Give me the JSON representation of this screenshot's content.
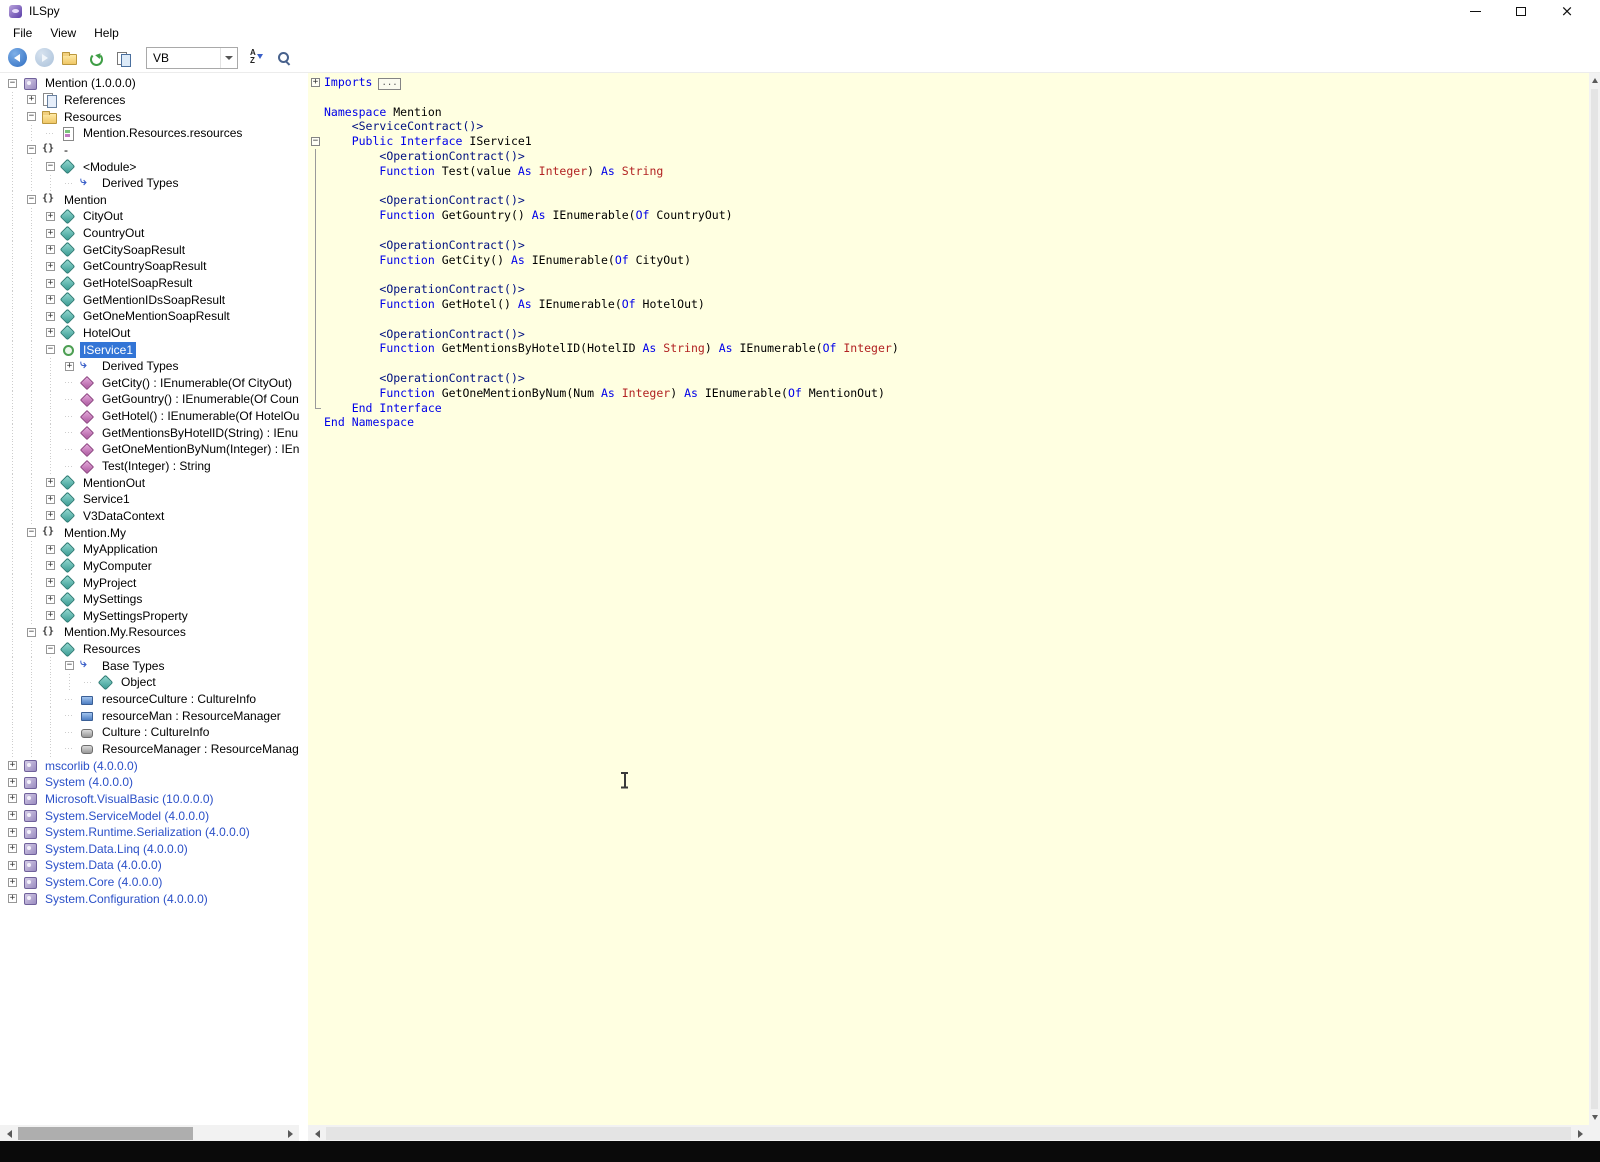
{
  "window": {
    "title": "ILSpy"
  },
  "menu": {
    "items": [
      "File",
      "View",
      "Help"
    ]
  },
  "toolbar": {
    "language": "VB"
  },
  "colors": {
    "code_background": "#FFFFE1",
    "tree_selection": "#3375D6",
    "keyword": "#0000E8",
    "builtin_type": "#B22222",
    "attribute": "#001080",
    "assembly_reference_text": "#2B50C8"
  },
  "tree": [
    {
      "d": 0,
      "e": "-",
      "i": "assembly",
      "t": "Mention (1.0.0.0)"
    },
    {
      "d": 1,
      "e": "+",
      "i": "references",
      "t": "References"
    },
    {
      "d": 1,
      "e": "-",
      "i": "folder",
      "t": "Resources"
    },
    {
      "d": 2,
      "e": "",
      "i": "resource",
      "t": "Mention.Resources.resources"
    },
    {
      "d": 1,
      "e": "-",
      "i": "namespace",
      "t": "-"
    },
    {
      "d": 2,
      "e": "-",
      "i": "class",
      "t": "<Module>"
    },
    {
      "d": 3,
      "e": "",
      "i": "derived",
      "t": "Derived Types"
    },
    {
      "d": 1,
      "e": "-",
      "i": "namespace",
      "t": "Mention"
    },
    {
      "d": 2,
      "e": "+",
      "i": "class",
      "t": "CityOut"
    },
    {
      "d": 2,
      "e": "+",
      "i": "class",
      "t": "CountryOut"
    },
    {
      "d": 2,
      "e": "+",
      "i": "class",
      "t": "GetCitySoapResult"
    },
    {
      "d": 2,
      "e": "+",
      "i": "class",
      "t": "GetCountrySoapResult"
    },
    {
      "d": 2,
      "e": "+",
      "i": "class",
      "t": "GetHotelSoapResult"
    },
    {
      "d": 2,
      "e": "+",
      "i": "class",
      "t": "GetMentionIDsSoapResult"
    },
    {
      "d": 2,
      "e": "+",
      "i": "class",
      "t": "GetOneMentionSoapResult"
    },
    {
      "d": 2,
      "e": "+",
      "i": "class",
      "t": "HotelOut"
    },
    {
      "d": 2,
      "e": "-",
      "i": "interface",
      "t": "IService1",
      "sel": true
    },
    {
      "d": 3,
      "e": "+",
      "i": "derived",
      "t": "Derived Types"
    },
    {
      "d": 3,
      "e": "",
      "i": "method",
      "t": "GetCity() : IEnumerable(Of CityOut)"
    },
    {
      "d": 3,
      "e": "",
      "i": "method",
      "t": "GetGountry() : IEnumerable(Of CountryOut)"
    },
    {
      "d": 3,
      "e": "",
      "i": "method",
      "t": "GetHotel() : IEnumerable(Of HotelOut)"
    },
    {
      "d": 3,
      "e": "",
      "i": "method",
      "t": "GetMentionsByHotelID(String) : IEnumerable(Of Integer)"
    },
    {
      "d": 3,
      "e": "",
      "i": "method",
      "t": "GetOneMentionByNum(Integer) : IEnumerable(Of MentionOut)"
    },
    {
      "d": 3,
      "e": "",
      "i": "method",
      "t": "Test(Integer) : String"
    },
    {
      "d": 2,
      "e": "+",
      "i": "class",
      "t": "MentionOut"
    },
    {
      "d": 2,
      "e": "+",
      "i": "class",
      "t": "Service1"
    },
    {
      "d": 2,
      "e": "+",
      "i": "class",
      "t": "V3DataContext"
    },
    {
      "d": 1,
      "e": "-",
      "i": "namespace",
      "t": "Mention.My"
    },
    {
      "d": 2,
      "e": "+",
      "i": "class",
      "t": "MyApplication"
    },
    {
      "d": 2,
      "e": "+",
      "i": "class",
      "t": "MyComputer"
    },
    {
      "d": 2,
      "e": "+",
      "i": "class",
      "t": "MyProject"
    },
    {
      "d": 2,
      "e": "+",
      "i": "class",
      "t": "MySettings"
    },
    {
      "d": 2,
      "e": "+",
      "i": "class",
      "t": "MySettingsProperty"
    },
    {
      "d": 1,
      "e": "-",
      "i": "namespace",
      "t": "Mention.My.Resources"
    },
    {
      "d": 2,
      "e": "-",
      "i": "class",
      "t": "Resources"
    },
    {
      "d": 3,
      "e": "-",
      "i": "derived",
      "t": "Base Types"
    },
    {
      "d": 4,
      "e": "",
      "i": "class",
      "t": "Object"
    },
    {
      "d": 3,
      "e": "",
      "i": "field",
      "t": "resourceCulture : CultureInfo"
    },
    {
      "d": 3,
      "e": "",
      "i": "field",
      "t": "resourceMan : ResourceManager"
    },
    {
      "d": 3,
      "e": "",
      "i": "property",
      "t": "Culture : CultureInfo"
    },
    {
      "d": 3,
      "e": "",
      "i": "property",
      "t": "ResourceManager : ResourceManager"
    },
    {
      "d": 0,
      "e": "+",
      "i": "assembly",
      "t": "mscorlib (4.0.0.0)",
      "blue": true
    },
    {
      "d": 0,
      "e": "+",
      "i": "assembly",
      "t": "System (4.0.0.0)",
      "blue": true
    },
    {
      "d": 0,
      "e": "+",
      "i": "assembly",
      "t": "Microsoft.VisualBasic (10.0.0.0)",
      "blue": true
    },
    {
      "d": 0,
      "e": "+",
      "i": "assembly",
      "t": "System.ServiceModel (4.0.0.0)",
      "blue": true
    },
    {
      "d": 0,
      "e": "+",
      "i": "assembly",
      "t": "System.Runtime.Serialization (4.0.0.0)",
      "blue": true
    },
    {
      "d": 0,
      "e": "+",
      "i": "assembly",
      "t": "System.Data.Linq (4.0.0.0)",
      "blue": true
    },
    {
      "d": 0,
      "e": "+",
      "i": "assembly",
      "t": "System.Data (4.0.0.0)",
      "blue": true
    },
    {
      "d": 0,
      "e": "+",
      "i": "assembly",
      "t": "System.Core (4.0.0.0)",
      "blue": true
    },
    {
      "d": 0,
      "e": "+",
      "i": "assembly",
      "t": "System.Configuration (4.0.0.0)",
      "blue": true
    }
  ],
  "code": {
    "lines": [
      {
        "fold": "plus",
        "seg": [
          [
            "k",
            "Imports"
          ]
        ],
        "box": "..."
      },
      {
        "seg": []
      },
      {
        "seg": [
          [
            "k",
            "Namespace"
          ],
          [
            "p",
            " Mention"
          ]
        ]
      },
      {
        "ind": 1,
        "seg": [
          [
            "a",
            "<ServiceContract()>"
          ]
        ]
      },
      {
        "fold": "minus",
        "ind": 1,
        "seg": [
          [
            "k",
            "Public Interface"
          ],
          [
            "p",
            " IService1"
          ]
        ]
      },
      {
        "fold": "line",
        "ind": 2,
        "seg": [
          [
            "a",
            "<OperationContract()>"
          ]
        ]
      },
      {
        "fold": "line",
        "ind": 2,
        "seg": [
          [
            "k",
            "Function"
          ],
          [
            "p",
            " Test(value "
          ],
          [
            "k",
            "As"
          ],
          [
            "t",
            " Integer"
          ],
          [
            "p",
            ") "
          ],
          [
            "k",
            "As"
          ],
          [
            "t",
            " String"
          ]
        ]
      },
      {
        "fold": "line",
        "seg": []
      },
      {
        "fold": "line",
        "ind": 2,
        "seg": [
          [
            "a",
            "<OperationContract()>"
          ]
        ]
      },
      {
        "fold": "line",
        "ind": 2,
        "seg": [
          [
            "k",
            "Function"
          ],
          [
            "p",
            " GetGountry() "
          ],
          [
            "k",
            "As"
          ],
          [
            "p",
            " IEnumerable("
          ],
          [
            "k",
            "Of"
          ],
          [
            "p",
            " CountryOut)"
          ]
        ]
      },
      {
        "fold": "line",
        "seg": []
      },
      {
        "fold": "line",
        "ind": 2,
        "seg": [
          [
            "a",
            "<OperationContract()>"
          ]
        ]
      },
      {
        "fold": "line",
        "ind": 2,
        "seg": [
          [
            "k",
            "Function"
          ],
          [
            "p",
            " GetCity() "
          ],
          [
            "k",
            "As"
          ],
          [
            "p",
            " IEnumerable("
          ],
          [
            "k",
            "Of"
          ],
          [
            "p",
            " CityOut)"
          ]
        ]
      },
      {
        "fold": "line",
        "seg": []
      },
      {
        "fold": "line",
        "ind": 2,
        "seg": [
          [
            "a",
            "<OperationContract()>"
          ]
        ]
      },
      {
        "fold": "line",
        "ind": 2,
        "seg": [
          [
            "k",
            "Function"
          ],
          [
            "p",
            " GetHotel() "
          ],
          [
            "k",
            "As"
          ],
          [
            "p",
            " IEnumerable("
          ],
          [
            "k",
            "Of"
          ],
          [
            "p",
            " HotelOut)"
          ]
        ]
      },
      {
        "fold": "line",
        "seg": []
      },
      {
        "fold": "line",
        "ind": 2,
        "seg": [
          [
            "a",
            "<OperationContract()>"
          ]
        ]
      },
      {
        "fold": "line",
        "ind": 2,
        "seg": [
          [
            "k",
            "Function"
          ],
          [
            "p",
            " GetMentionsByHotelID(HotelID "
          ],
          [
            "k",
            "As"
          ],
          [
            "t",
            " String"
          ],
          [
            "p",
            ") "
          ],
          [
            "k",
            "As"
          ],
          [
            "p",
            " IEnumerable("
          ],
          [
            "k",
            "Of"
          ],
          [
            "t",
            " Integer"
          ],
          [
            "p",
            ")"
          ]
        ]
      },
      {
        "fold": "line",
        "seg": []
      },
      {
        "fold": "line",
        "ind": 2,
        "seg": [
          [
            "a",
            "<OperationContract()>"
          ]
        ]
      },
      {
        "fold": "line",
        "ind": 2,
        "seg": [
          [
            "k",
            "Function"
          ],
          [
            "p",
            " GetOneMentionByNum(Num "
          ],
          [
            "k",
            "As"
          ],
          [
            "t",
            " Integer"
          ],
          [
            "p",
            ") "
          ],
          [
            "k",
            "As"
          ],
          [
            "p",
            " IEnumerable("
          ],
          [
            "k",
            "Of"
          ],
          [
            "p",
            " MentionOut)"
          ]
        ]
      },
      {
        "fold": "end",
        "ind": 1,
        "seg": [
          [
            "k",
            "End Interface"
          ]
        ]
      },
      {
        "seg": [
          [
            "k",
            "End Namespace"
          ]
        ]
      }
    ]
  }
}
